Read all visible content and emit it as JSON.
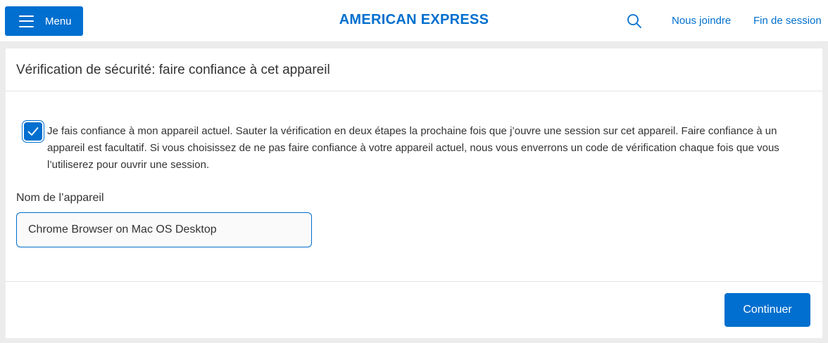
{
  "header": {
    "menu_label": "Menu",
    "brand": "AMERICAN EXPRESS",
    "search_icon": "search-icon",
    "contact_label": "Nous joindre",
    "logout_label": "Fin de session"
  },
  "card": {
    "title": "Vérification de sécurité: faire confiance à cet appareil",
    "trust_checkbox": {
      "checked": true,
      "label": "Je fais confiance à mon appareil actuel. Sauter la vérification en deux étapes la prochaine fois que j’ouvre une session sur cet appareil. Faire confiance à un appareil est facultatif. Si vous choisissez de ne pas faire confiance à votre appareil actuel, nous vous enverrons un code de vérification chaque fois que vous l’utiliserez pour ouvrir une session."
    },
    "device_name": {
      "label": "Nom de l’appareil",
      "value": "Chrome Browser on Mac OS Desktop"
    },
    "continue_label": "Continuer"
  },
  "colors": {
    "brand_blue": "#006fcf",
    "page_background": "#ececec",
    "text": "#333333"
  }
}
